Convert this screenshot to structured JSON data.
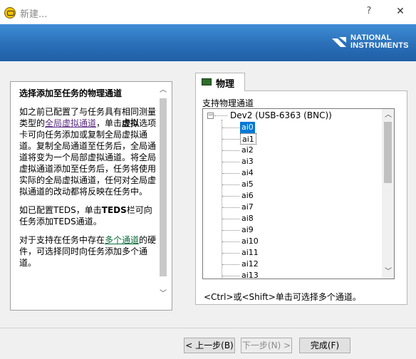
{
  "window": {
    "title": "新建...",
    "help": "?",
    "close": "✕"
  },
  "brand": {
    "line1": "NATIONAL",
    "line2": "INSTRUMENTS"
  },
  "help": {
    "title": "选择添加至任务的物理通道",
    "p1_a": "如之前已配置了与任务具有相同测量类型的",
    "p1_link": "全局虚拟通道",
    "p1_b": "，单击",
    "p1_bold": "虚拟",
    "p1_c": "选项卡可向任务添加或复制全局虚拟通道。复制全局通道至任务后，全局通道将变为一个局部虚拟通道。将全局虚拟通道添加至任务后，任务将使用实际的全局虚拟通道，任何对全局虚拟通道的改动都将反映在任务中。",
    "p2_a": "如已配置TEDS，单击",
    "p2_bold": "TEDS",
    "p2_b": "栏可向任务添加TEDS通道。",
    "p3_a": "对于支持在任务中存在",
    "p3_link": "多个通道",
    "p3_b": "的硬件，可选择同时向任务添加多个通道。"
  },
  "tab": {
    "label": "物理"
  },
  "channels": {
    "label": "支持物理通道",
    "device": "Dev2  (USB-6363 (BNC))",
    "items": [
      "ai0",
      "ai1",
      "ai2",
      "ai3",
      "ai4",
      "ai5",
      "ai6",
      "ai7",
      "ai8",
      "ai9",
      "ai10",
      "ai11",
      "ai12",
      "ai13"
    ],
    "selected": "ai0"
  },
  "hint": "<Ctrl>或<Shift>单击可选择多个通道。",
  "buttons": {
    "back": "< 上一步(B)",
    "next": "下一步(N) >",
    "finish": "完成(F)"
  }
}
